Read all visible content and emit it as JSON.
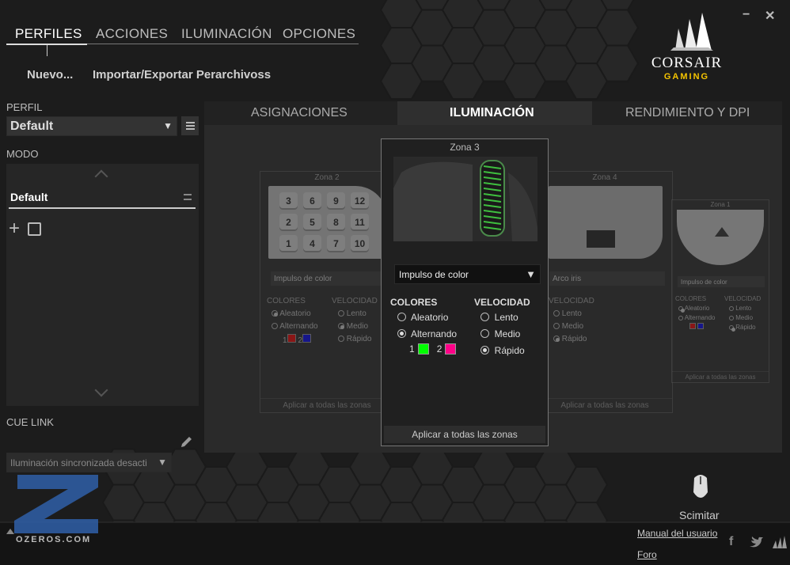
{
  "window": {
    "minimize_label": "−",
    "close_label": "✕"
  },
  "nav": {
    "tabs": [
      "PERFILES",
      "ACCIONES",
      "ILUMINACIÓN",
      "OPCIONES"
    ]
  },
  "subactions": {
    "new": "Nuevo...",
    "import_export": "Importar/Exportar Perarchivoss"
  },
  "brand": {
    "name": "CORSAIR",
    "sub": "GAMING"
  },
  "sidebar": {
    "perfil_label": "PERFIL",
    "perfil_value": "Default",
    "modo_label": "MODO",
    "mode_item": "Default",
    "cue_link_label": "CUE LINK",
    "cue_link_value": "Iluminación sincronizada desacti"
  },
  "content_tabs": [
    "ASIGNACIONES",
    "ILUMINACIÓN",
    "RENDIMIENTO Y DPI"
  ],
  "zones": {
    "zona2": {
      "title": "Zona 2",
      "effect": "Impulso de color",
      "colors_label": "COLORES",
      "speed_label": "VELOCIDAD",
      "opt1": "Aleatorio",
      "opt2": "Alternando",
      "spd1": "Lento",
      "spd2": "Medio",
      "spd3": "Rápido",
      "c1": "1",
      "c2": "2",
      "apply": "Aplicar a todas las zonas",
      "keys": [
        "3",
        "6",
        "9",
        "12",
        "2",
        "5",
        "8",
        "11",
        "1",
        "4",
        "7",
        "10"
      ],
      "color1": "#ff0000",
      "color2": "#0000ff"
    },
    "zona3": {
      "title": "Zona 3",
      "effect": "Impulso de color",
      "colors_label": "COLORES",
      "speed_label": "VELOCIDAD",
      "opt1": "Aleatorio",
      "opt2": "Alternando",
      "spd1": "Lento",
      "spd2": "Medio",
      "spd3": "Rápido",
      "c1": "1",
      "c2": "2",
      "apply": "Aplicar a todas las zonas",
      "color1": "#00ff00",
      "color2": "#ff00aa"
    },
    "zona4": {
      "title": "Zona 4",
      "effect": "Arco iris",
      "speed_label": "VELOCIDAD",
      "spd1": "Lento",
      "spd2": "Medio",
      "spd3": "Rápido",
      "apply": "Aplicar a todas las zonas"
    },
    "zona1": {
      "title": "Zona 1",
      "effect": "Impulso de color",
      "colors_label": "COLORES",
      "speed_label": "VELOCIDAD",
      "opt1": "Aleatorio",
      "opt2": "Alternando",
      "spd1": "Lento",
      "spd2": "Medio",
      "spd3": "Rápido",
      "apply": "Aplicar a todas las zonas",
      "color1": "#ff0000",
      "color2": "#0000ff"
    }
  },
  "device": {
    "name": "Scimitar"
  },
  "footer": {
    "manual": "Manual del usuario",
    "forum": "Foro"
  },
  "watermark": {
    "text": "OZEROS.COM"
  }
}
